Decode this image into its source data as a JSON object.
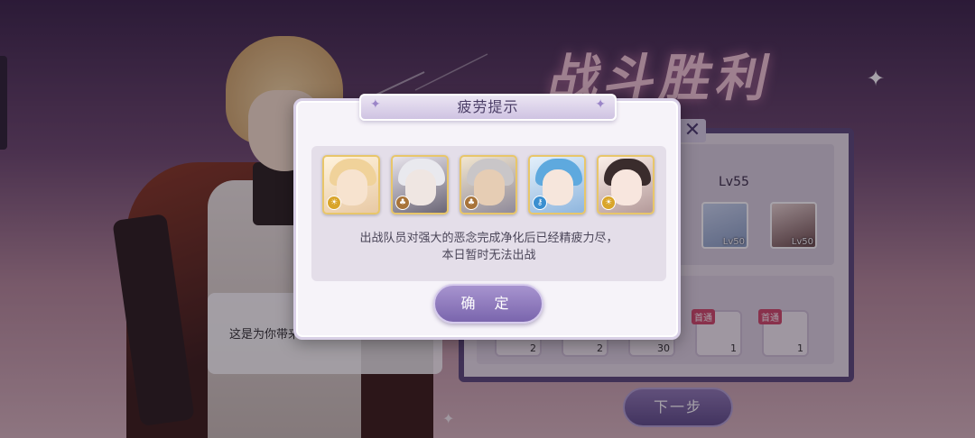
{
  "background": {
    "victory_title": "战斗胜利",
    "speech_text": "这是为你带来",
    "level_label": "Lv55",
    "party": [
      {
        "level": "Lv50"
      },
      {
        "level": "Lv50"
      }
    ],
    "loot": [
      {
        "count": "2",
        "tag": ""
      },
      {
        "count": "2",
        "tag": ""
      },
      {
        "count": "30",
        "tag": ""
      },
      {
        "count": "1",
        "tag": "首通"
      },
      {
        "count": "1",
        "tag": "首通"
      }
    ],
    "next_button": "下一步",
    "close_icon": "✕"
  },
  "modal": {
    "title": "疲劳提示",
    "sparkle_icon": "✦",
    "message_line1": "出战队员对强大的恶念完成净化后已经精疲力尽，",
    "message_line2": "本日暂时无法出战",
    "confirm_button": "确 定",
    "members": [
      {
        "icon": "blonde-boy-portrait",
        "badge_icon": "sun-badge-icon",
        "badge_color": "#d9a52a"
      },
      {
        "icon": "white-hair-masked-portrait",
        "badge_icon": "leaf-badge-icon",
        "badge_color": "#a8743a"
      },
      {
        "icon": "grey-bearded-man-portrait",
        "badge_icon": "leaf-badge-icon",
        "badge_color": "#a8743a"
      },
      {
        "icon": "blue-hair-boy-portrait",
        "badge_icon": "key-badge-icon",
        "badge_color": "#3a8fd0"
      },
      {
        "icon": "dark-hair-girl-portrait",
        "badge_icon": "sun-badge-icon",
        "badge_color": "#d9a52a"
      }
    ]
  },
  "colors": {
    "accent": "#7a65ad",
    "card_border": "#e8c66a"
  }
}
